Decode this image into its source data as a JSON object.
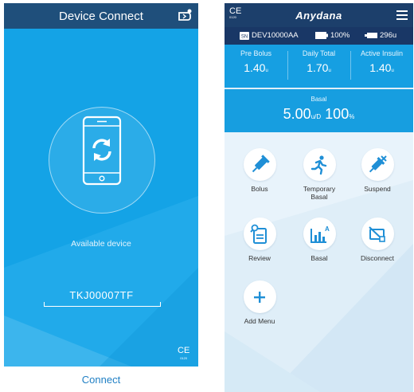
{
  "left": {
    "title": "Device Connect",
    "available_label": "Available device",
    "device_name": "TKJ00007TF",
    "ce_mark": "CE",
    "ce_number": "0120",
    "connect_label": "Connect"
  },
  "right": {
    "ce_mark": "CE",
    "ce_number": "0120",
    "logo": "Anydana",
    "status": {
      "device_id": "DEV10000AA",
      "battery": "100%",
      "reservoir": "296u"
    },
    "metrics": [
      {
        "label": "Pre Bolus",
        "value": "1.40",
        "unit": "u"
      },
      {
        "label": "Daily Total",
        "value": "1.70",
        "unit": "u"
      },
      {
        "label": "Active Insulin",
        "value": "1.40",
        "unit": "u"
      }
    ],
    "basal": {
      "label": "Basal",
      "rate": "5.00",
      "rate_unit": "u/D",
      "percent": "100",
      "percent_unit": "%"
    },
    "tiles": {
      "bolus": "Bolus",
      "temp_basal_1": "Temporary",
      "temp_basal_2": "Basal",
      "suspend": "Suspend",
      "review": "Review",
      "basal": "Basal",
      "disconnect": "Disconnect",
      "add_menu": "Add Menu"
    }
  },
  "colors": {
    "accent": "#14a3e6",
    "header_dark": "#1c3f6b",
    "icon_blue": "#1f8fd6"
  }
}
